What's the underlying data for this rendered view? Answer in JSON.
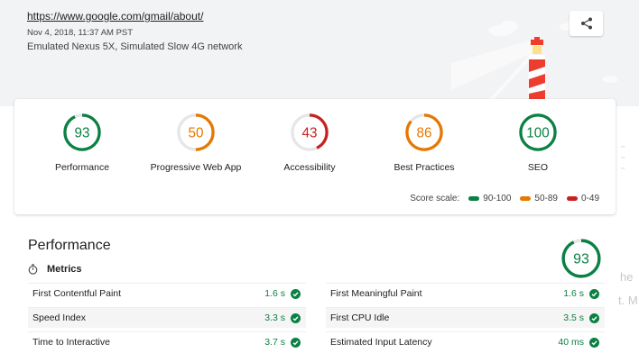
{
  "header": {
    "url": "https://www.google.com/gmail/about/",
    "date": "Nov 4, 2018, 11:37 AM PST",
    "environment": "Emulated Nexus 5X, Simulated Slow 4G network"
  },
  "gauges": [
    {
      "score": "93",
      "label": "Performance",
      "color": "#0b8043",
      "fraction": 0.93
    },
    {
      "score": "50",
      "label": "Progressive Web App",
      "color": "#e67700",
      "fraction": 0.5
    },
    {
      "score": "43",
      "label": "Accessibility",
      "color": "#c7221f",
      "fraction": 0.43
    },
    {
      "score": "86",
      "label": "Best Practices",
      "color": "#e67700",
      "fraction": 0.86
    },
    {
      "score": "100",
      "label": "SEO",
      "color": "#0b8043",
      "fraction": 1.0
    }
  ],
  "scale": {
    "label": "Score scale:",
    "ranges": [
      {
        "text": "90-100",
        "color": "#0b8043"
      },
      {
        "text": "50-89",
        "color": "#e67700"
      },
      {
        "text": "0-49",
        "color": "#c7221f"
      }
    ]
  },
  "performance": {
    "title": "Performance",
    "score": "93",
    "fraction": 0.93,
    "metrics_heading": "Metrics",
    "metrics_left": [
      {
        "name": "First Contentful Paint",
        "value": "1.6 s"
      },
      {
        "name": "Speed Index",
        "value": "3.3 s"
      },
      {
        "name": "Time to Interactive",
        "value": "3.7 s"
      }
    ],
    "metrics_right": [
      {
        "name": "First Meaningful Paint",
        "value": "1.6 s"
      },
      {
        "name": "First CPU Idle",
        "value": "3.5 s"
      },
      {
        "name": "Estimated Input Latency",
        "value": "40 ms"
      }
    ]
  },
  "background_ghost": {
    "line1": "he",
    "line2": "t. M"
  }
}
